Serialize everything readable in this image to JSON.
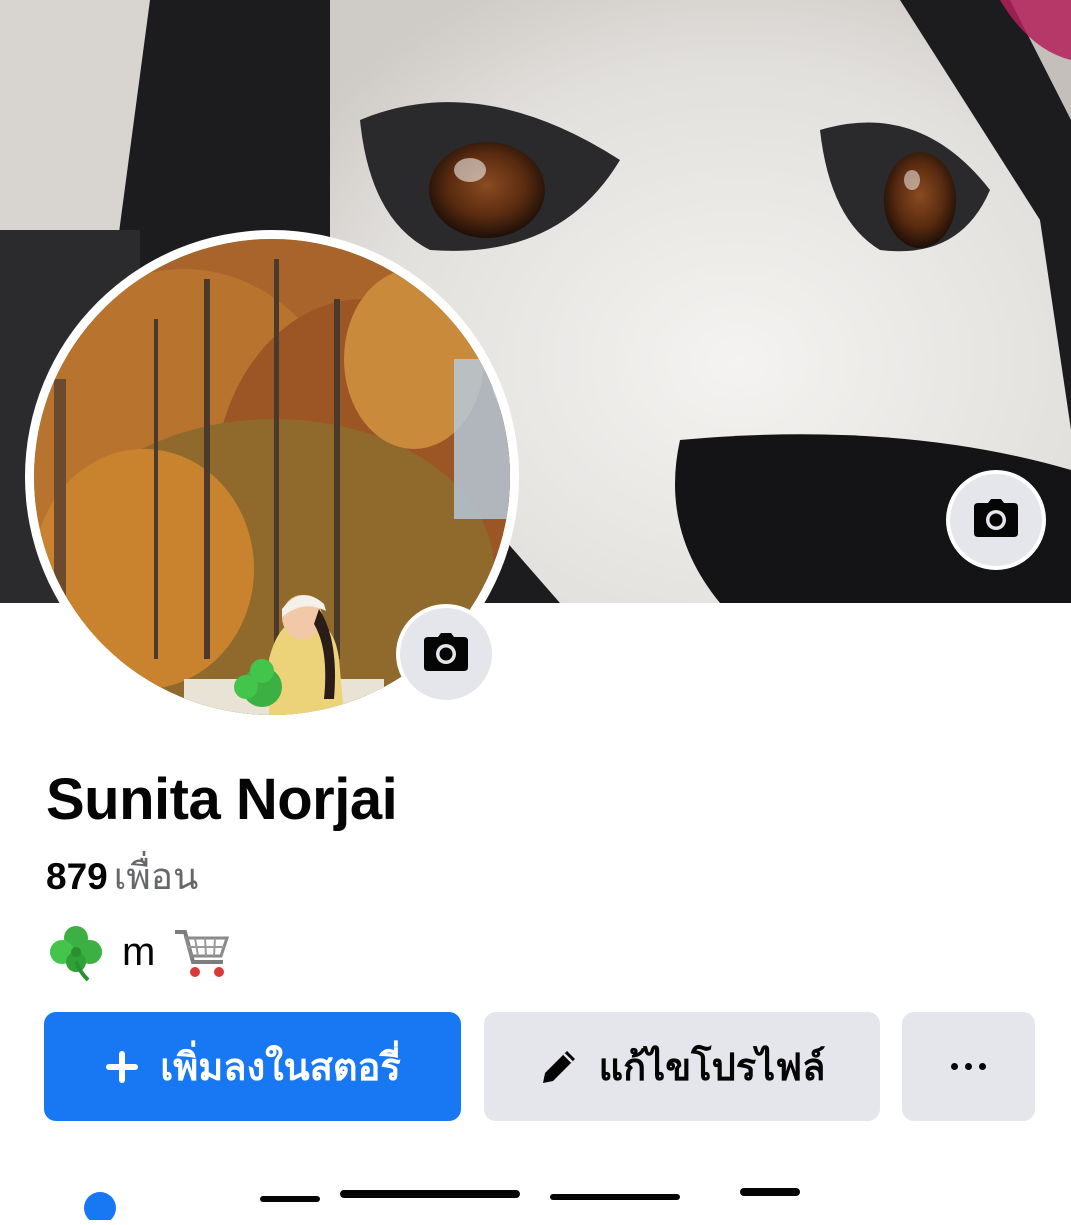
{
  "profile": {
    "name": "Sunita Norjai",
    "friends_count": "879",
    "friends_label": "เพื่อน",
    "bio_text": "m"
  },
  "actions": {
    "add_story_label": "เพิ่มลงในสตอรี่",
    "edit_profile_label": "แก้ไขโปรไฟล์",
    "more_label": "..."
  },
  "icons": {
    "cover_camera": "camera-icon",
    "avatar_camera": "camera-icon",
    "add_story": "plus-icon",
    "edit_profile": "pencil-icon",
    "more": "more-dots-icon",
    "bio_leading": "four-leaf-clover-icon",
    "bio_trailing": "shopping-cart-icon"
  },
  "colors": {
    "primary": "#1877f2",
    "secondary_bg": "#e4e6eb",
    "text": "#050505",
    "muted_text": "#65676b"
  }
}
